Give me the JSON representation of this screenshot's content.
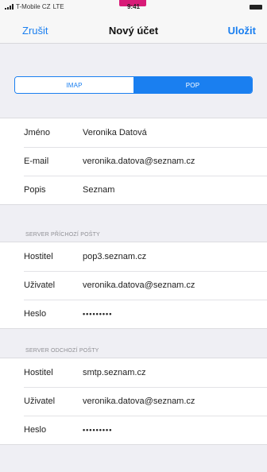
{
  "status_bar": {
    "carrier": "T-Mobile CZ",
    "network": "LTE",
    "time": "9:41"
  },
  "nav": {
    "cancel_label": "Zrušit",
    "title": "Nový účet",
    "save_label": "Uložit"
  },
  "segmented_control": {
    "options": [
      "IMAP",
      "POP"
    ],
    "selected": "POP"
  },
  "account": {
    "rows": [
      {
        "label": "Jméno",
        "value": "Veronika Datová"
      },
      {
        "label": "E-mail",
        "value": "veronika.datova@seznam.cz"
      },
      {
        "label": "Popis",
        "value": "Seznam"
      }
    ]
  },
  "incoming": {
    "header": "SERVER PŘÍCHOZÍ POŠTY",
    "rows": [
      {
        "label": "Hostitel",
        "value": "pop3.seznam.cz"
      },
      {
        "label": "Uživatel",
        "value": "veronika.datova@seznam.cz"
      },
      {
        "label": "Heslo",
        "value": "•••••••••"
      }
    ]
  },
  "outgoing": {
    "header": "SERVER ODCHOZÍ POŠTY",
    "rows": [
      {
        "label": "Hostitel",
        "value": "smtp.seznam.cz"
      },
      {
        "label": "Uživatel",
        "value": "veronika.datova@seznam.cz"
      },
      {
        "label": "Heslo",
        "value": "•••••••••"
      }
    ]
  },
  "colors": {
    "accent": "#1a7ff0",
    "background": "#efeff4",
    "carrier_accent": "#d81b78"
  }
}
